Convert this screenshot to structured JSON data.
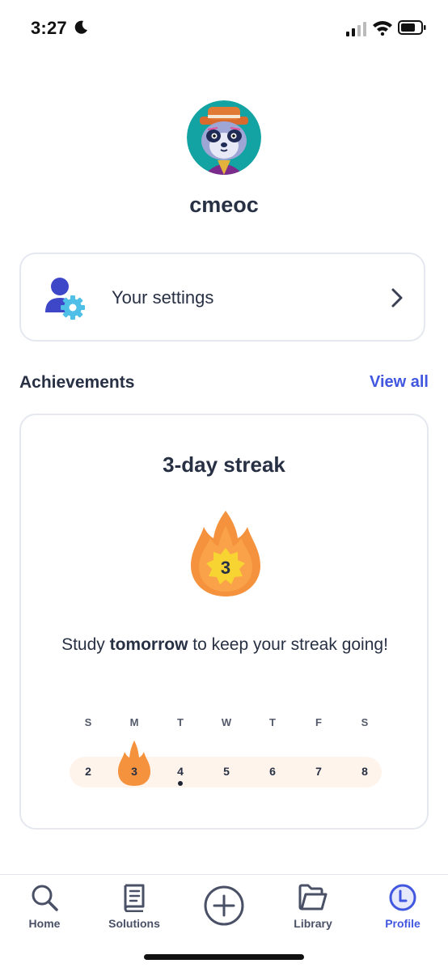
{
  "status_bar": {
    "time": "3:27"
  },
  "profile": {
    "username": "cmeoc",
    "avatar_icon": "panda-avatar-icon"
  },
  "settings": {
    "label": "Your settings",
    "icon": "user-gear-icon"
  },
  "achievements": {
    "title": "Achievements",
    "view_all": "View all",
    "streak": {
      "title": "3-day streak",
      "count": "3",
      "message_prefix": "Study ",
      "message_bold": "tomorrow",
      "message_suffix": " to keep your streak going!",
      "week_letters": [
        "S",
        "M",
        "T",
        "W",
        "T",
        "F",
        "S"
      ],
      "days": [
        "2",
        "3",
        "4",
        "5",
        "6",
        "7",
        "8"
      ],
      "streak_day_index": 1,
      "today_index": 2
    }
  },
  "nav": {
    "items": [
      {
        "label": "Home",
        "icon": "search-icon"
      },
      {
        "label": "Solutions",
        "icon": "book-icon"
      },
      {
        "label": "",
        "icon": "plus-circle-icon"
      },
      {
        "label": "Library",
        "icon": "folder-icon"
      },
      {
        "label": "Profile",
        "icon": "profile-icon"
      }
    ],
    "active_index": 4
  },
  "colors": {
    "accent": "#4257e0",
    "flame": "#f5923e",
    "flame_light": "#f9b45b",
    "sun": "#f7d432"
  }
}
